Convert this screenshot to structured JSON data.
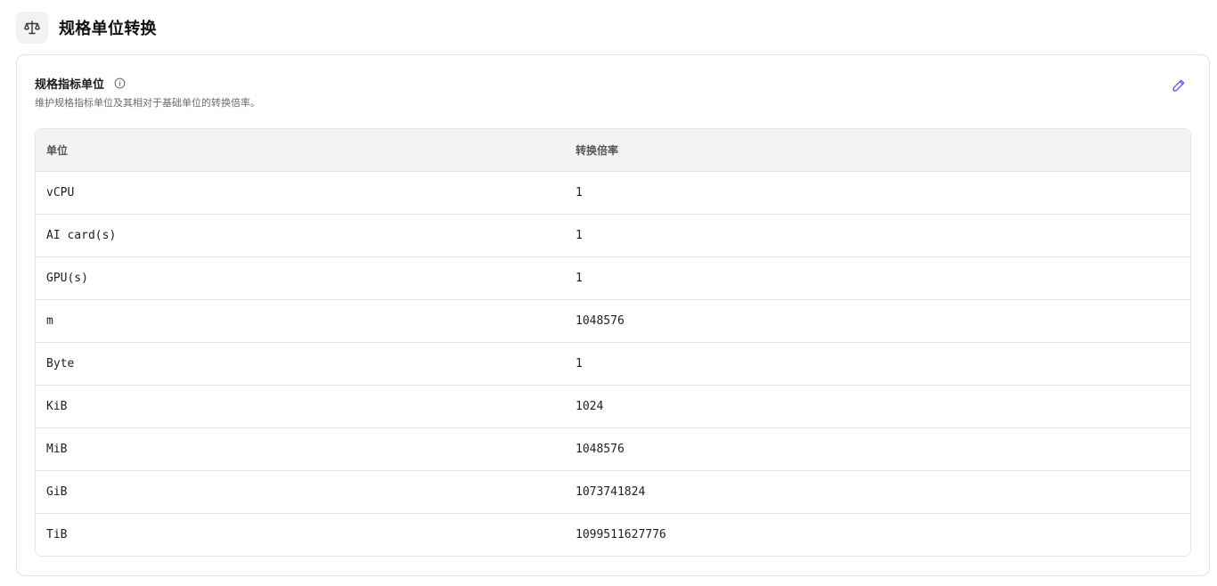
{
  "header": {
    "title": "规格单位转换",
    "icon": "scale-icon"
  },
  "card": {
    "title": "规格指标单位",
    "description": "维护规格指标单位及其相对于基础单位的转换倍率。",
    "info_icon": "info-icon",
    "edit_icon": "pencil-icon",
    "accent_color": "#6b4fd8"
  },
  "table": {
    "columns": [
      "单位",
      "转换倍率"
    ],
    "rows": [
      {
        "unit": "vCPU",
        "rate": "1"
      },
      {
        "unit": "AI card(s)",
        "rate": "1"
      },
      {
        "unit": "GPU(s)",
        "rate": "1"
      },
      {
        "unit": "m",
        "rate": "1048576"
      },
      {
        "unit": "Byte",
        "rate": "1"
      },
      {
        "unit": "KiB",
        "rate": "1024"
      },
      {
        "unit": "MiB",
        "rate": "1048576"
      },
      {
        "unit": "GiB",
        "rate": "1073741824"
      },
      {
        "unit": "TiB",
        "rate": "1099511627776"
      }
    ]
  }
}
